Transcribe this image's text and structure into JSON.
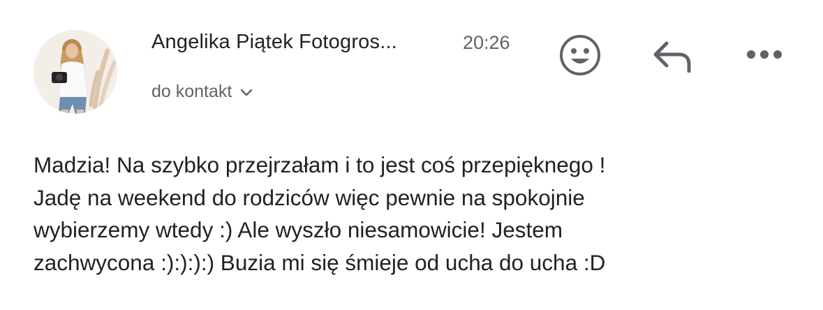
{
  "message": {
    "sender_name": "Angelika Piątek Fotogros...",
    "time": "20:26",
    "recipient_label": "do kontakt",
    "avatar_icon": "sender-photo-avatar",
    "body_lines": [
      "Madzia! Na szybko przejrzałam i to jest coś przepięknego !",
      "Jadę na weekend do rodziców więc pewnie na spokojnie",
      "wybierzemy wtedy :) Ale wyszło niesamowicie! Jestem",
      "zachwycona :):):):) Buzia mi się śmieje od ucha do ucha :D"
    ]
  },
  "actions": {
    "emoji_icon": "smiley-face-icon",
    "reply_icon": "reply-arrow-icon",
    "more_icon": "more-horizontal-icon"
  },
  "colors": {
    "text_primary": "#202124",
    "text_secondary": "#5f6368",
    "icon_gray": "#5f6368",
    "background": "#ffffff"
  }
}
